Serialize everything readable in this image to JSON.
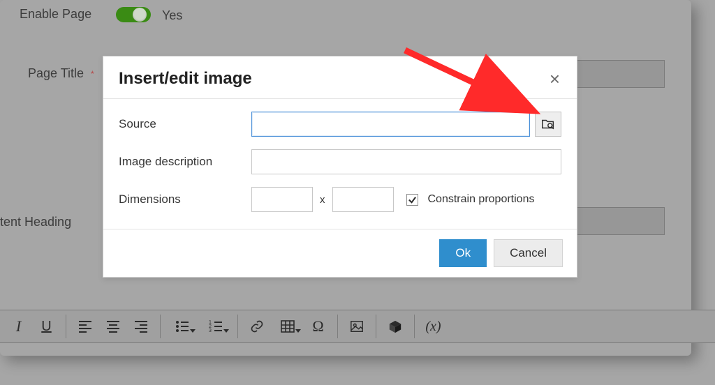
{
  "background": {
    "enable_page": {
      "label": "Enable Page",
      "value_text": "Yes",
      "enabled": true
    },
    "page_title": {
      "label": "Page Title"
    },
    "content_heading": {
      "label": "tent Heading"
    }
  },
  "toolbar": {
    "italic": "I",
    "underline": "U",
    "omega": "Ω",
    "variable": "(x)"
  },
  "dialog": {
    "title": "Insert/edit image",
    "close_glyph": "×",
    "source": {
      "label": "Source",
      "value": "",
      "placeholder": ""
    },
    "description": {
      "label": "Image description",
      "value": ""
    },
    "dimensions": {
      "label": "Dimensions",
      "width": "",
      "height": "",
      "constrain_checked": true,
      "constrain_label": "Constrain proportions",
      "separator": "x"
    },
    "ok": "Ok",
    "cancel": "Cancel"
  }
}
